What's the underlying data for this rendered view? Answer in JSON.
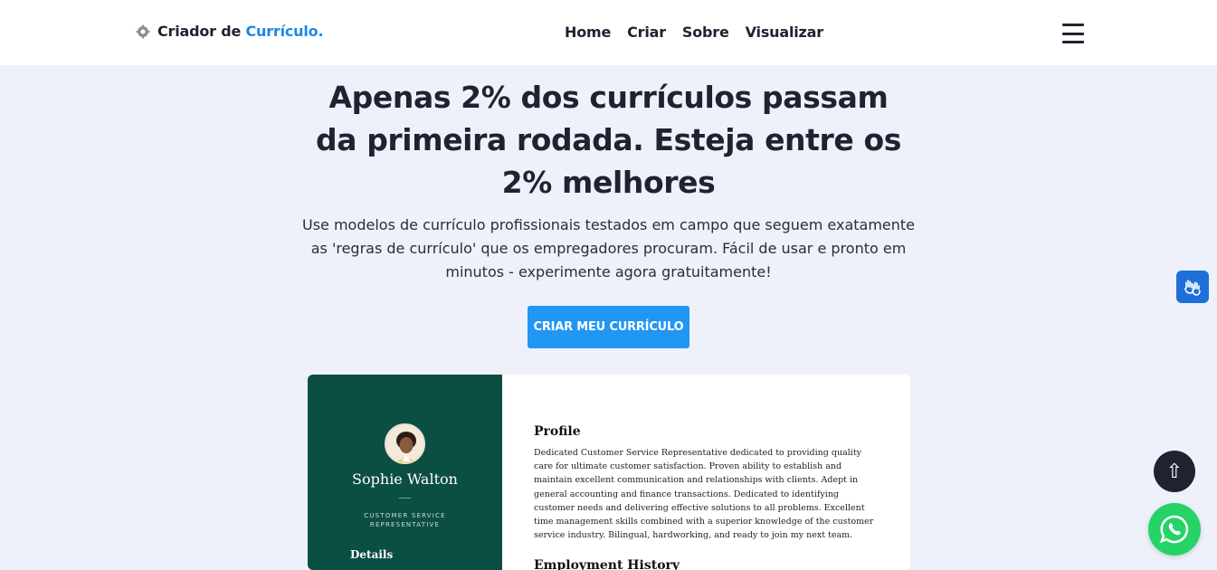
{
  "header": {
    "brand_prefix": "Criador de ",
    "brand_accent": "Currículo.",
    "nav": [
      "Home",
      "Criar",
      "Sobre",
      "Visualizar"
    ],
    "icons": {
      "logo": "gear-logo-icon",
      "menu": "hamburger-icon"
    }
  },
  "hero": {
    "title": "Apenas 2% dos currículos passam da primeira rodada. Esteja entre os 2% melhores",
    "subtitle": "Use modelos de currículo profissionais testados em campo que seguem exatamente as 'regras de currículo' que os empregadores procuram. Fácil de usar e pronto em minutos - experimente agora gratuitamente!",
    "cta_label": "CRIAR MEU CURRÍCULO"
  },
  "resume_preview": {
    "name": "Sophie Walton",
    "role": "CUSTOMER SERVICE REPRESENTATIVE",
    "details_heading": "Details",
    "profile_heading": "Profile",
    "profile_text": "Dedicated Customer Service Representative dedicated to providing quality care for ultimate customer satisfaction. Proven ability to establish and maintain excellent communication and relationships with clients. Adept in general accounting and finance transactions. Dedicated to identifying customer needs and delivering effective solutions to all problems. Excellent time management skills combined with a superior knowledge of the customer service industry. Bilingual, hardworking, and ready to join my next team.",
    "employment_heading": "Employment History"
  },
  "floating": {
    "back_to_top_icon": "arrow-up-icon",
    "back_to_top_glyph": "⇧",
    "accessibility_icon": "sign-language-icon",
    "whatsapp_icon": "whatsapp-icon"
  },
  "colors": {
    "accent": "#2196f3",
    "page_bg": "#eef1f9",
    "resume_sidebar": "#0b4f42",
    "dark": "#1f2230",
    "whatsapp": "#25d366",
    "accessibility": "#1e6fd9"
  }
}
